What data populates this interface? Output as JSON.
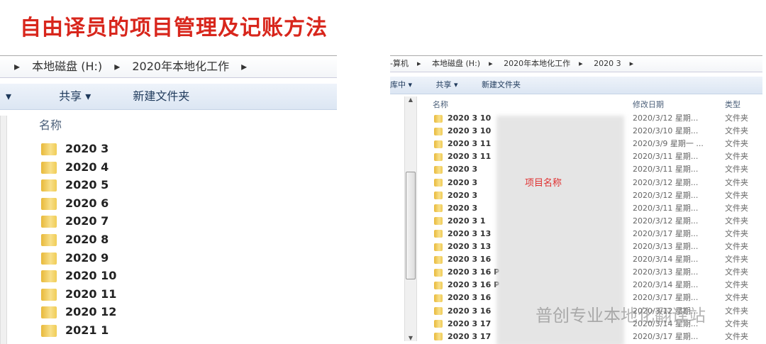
{
  "title": "自由译员的项目管理及记账方法",
  "left": {
    "breadcrumb": [
      "本地磁盘 (H:)",
      "2020年本地化工作"
    ],
    "toolbar": {
      "share": "共享 ▾",
      "new_folder": "新建文件夹"
    },
    "header_name": "名称",
    "folders": [
      "2020 3",
      "2020 4",
      "2020 5",
      "2020 6",
      "2020 7",
      "2020 8",
      "2020 9",
      "2020 10",
      "2020 11",
      "2020 12",
      "2021 1"
    ]
  },
  "right": {
    "breadcrumb": [
      "-算机",
      "本地磁盘 (H:)",
      "2020年本地化工作",
      "2020 3"
    ],
    "toolbar": {
      "library": "库中 ▾",
      "share": "共享 ▾",
      "new_folder": "新建文件夹"
    },
    "headers": {
      "name": "名称",
      "date": "修改日期",
      "type": "类型"
    },
    "annotation": "项目名称",
    "rows": [
      {
        "name": "2020 3 10",
        "date": "2020/3/12 星期...",
        "type": "文件夹"
      },
      {
        "name": "2020 3 10",
        "date": "2020/3/10 星期...",
        "type": "文件夹"
      },
      {
        "name": "2020 3 11",
        "date": "2020/3/9 星期一 ...",
        "type": "文件夹"
      },
      {
        "name": "2020 3 11",
        "date": "2020/3/11 星期...",
        "type": "文件夹"
      },
      {
        "name": "2020 3",
        "date": "2020/3/11 星期...",
        "type": "文件夹"
      },
      {
        "name": "2020 3",
        "date": "2020/3/12 星期...",
        "type": "文件夹"
      },
      {
        "name": "2020 3",
        "date": "2020/3/12 星期...",
        "type": "文件夹"
      },
      {
        "name": "2020 3",
        "date": "2020/3/11 星期...",
        "type": "文件夹"
      },
      {
        "name": "2020 3 1",
        "date": "2020/3/12 星期...",
        "type": "文件夹"
      },
      {
        "name": "2020 3 13",
        "date": "2020/3/17 星期...",
        "type": "文件夹"
      },
      {
        "name": "2020 3 13",
        "date": "2020/3/13 星期...",
        "type": "文件夹"
      },
      {
        "name": "2020 3 16",
        "date": "2020/3/14 星期...",
        "type": "文件夹"
      },
      {
        "name": "2020 3 16 P",
        "date": "2020/3/13 星期...",
        "type": "文件夹"
      },
      {
        "name": "2020 3 16 P",
        "date": "2020/3/14 星期...",
        "type": "文件夹"
      },
      {
        "name": "2020 3 16",
        "date": "2020/3/17 星期...",
        "type": "文件夹"
      },
      {
        "name": "2020 3 16",
        "date": "2020/3/12 星期...",
        "type": "文件夹"
      },
      {
        "name": "2020 3 17",
        "date": "2020/3/14 星期...",
        "type": "文件夹"
      },
      {
        "name": "2020 3 17",
        "date": "2020/3/17 星期...",
        "type": "文件夹"
      }
    ]
  },
  "watermark": "普创专业本地化翻译站"
}
